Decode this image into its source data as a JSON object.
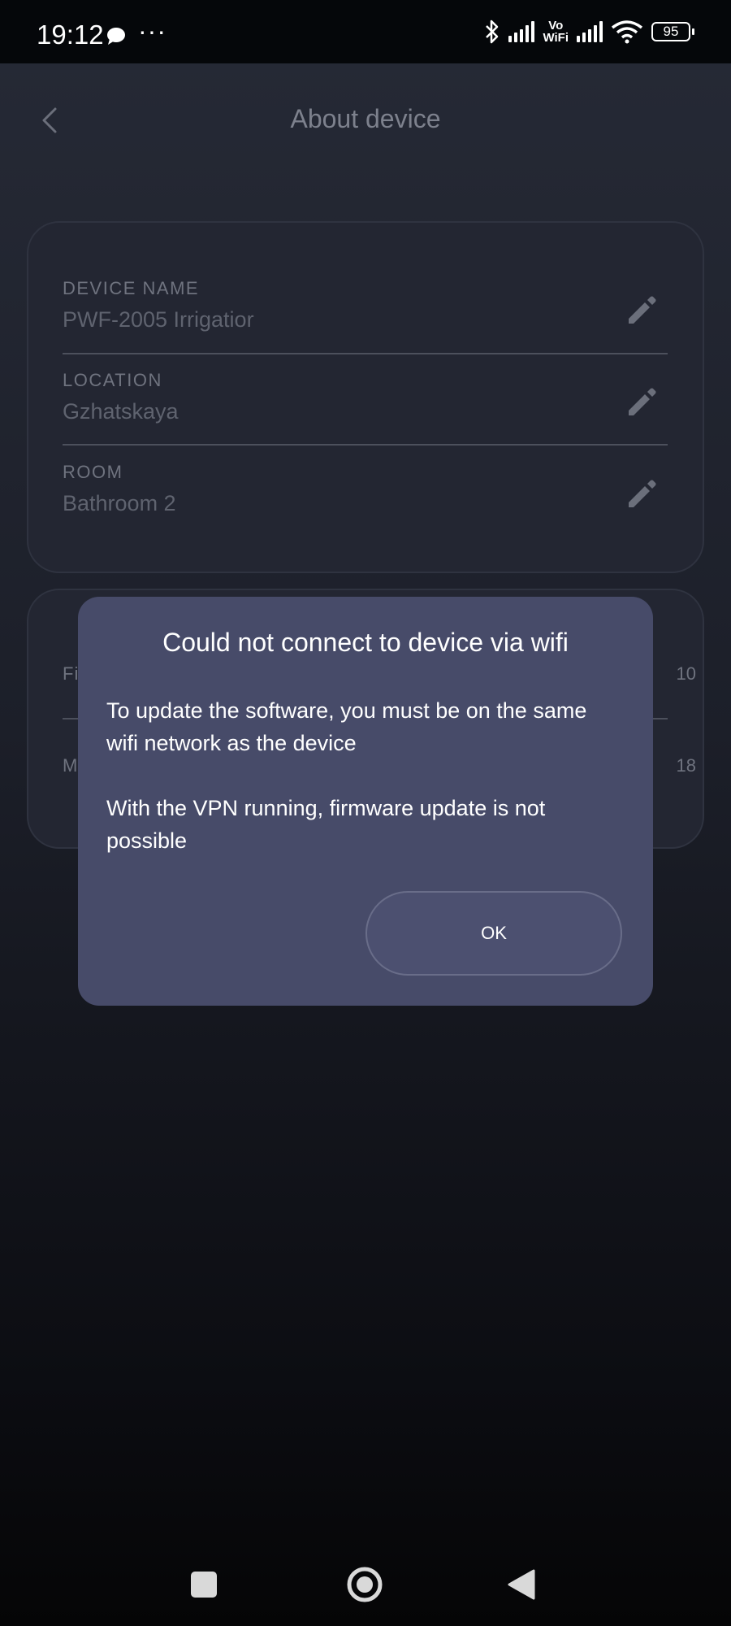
{
  "status_bar": {
    "time": "19:12",
    "more": "···",
    "vowifi_top": "Vo",
    "vowifi_bottom": "WiFi",
    "battery": "95",
    "icons": [
      "chat-icon",
      "bluetooth-icon",
      "signal-icon",
      "vowifi-icon",
      "signal-icon",
      "wifi-icon",
      "battery-icon"
    ]
  },
  "header": {
    "title": "About device",
    "back_icon": "chevron-left-icon"
  },
  "device_card": {
    "fields": [
      {
        "label": "DEVICE NAME",
        "value": "PWF-2005 Irrigatior"
      },
      {
        "label": "LOCATION",
        "value": "Gzhatskaya"
      },
      {
        "label": "ROOM",
        "value": "Bathroom 2"
      }
    ],
    "edit_icon": "pencil-icon"
  },
  "info_card": {
    "rows": [
      {
        "label": "Fi",
        "value": "10"
      },
      {
        "label": "M",
        "value": "18"
      }
    ]
  },
  "dialog": {
    "title": "Could not connect to device via wifi",
    "message_1": "To update the software, you must be on the same wifi network as the device",
    "message_2": "With the VPN running, firmware update is not possible",
    "ok_label": "OK"
  },
  "nav_bar": {
    "buttons": [
      "recent-apps-icon",
      "home-icon",
      "back-icon"
    ]
  },
  "colors": {
    "background": "#1c1f29",
    "card": "#232632",
    "dialog": "#474b69",
    "muted_text": "#6f737f"
  }
}
